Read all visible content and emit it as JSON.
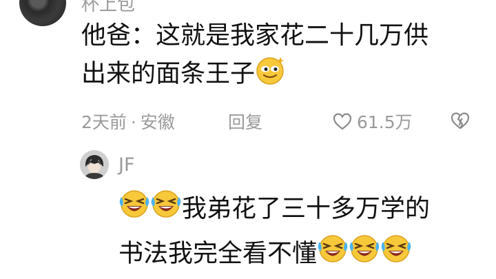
{
  "top_comment": {
    "username": "杯上包",
    "text_line1": "他爸：这就是我家花二十几万供",
    "text_line2": "出来的面条王子",
    "emoji": "smirk-face-emoji",
    "time": "2天前",
    "location": "安徽",
    "reply_label": "回复",
    "like_count": "61.5万"
  },
  "reply": {
    "username": "JF",
    "text_line1": "我弟花了三十多万学的",
    "text_line2": "书法我完全看不懂",
    "emoji": "laughing-crying-emoji"
  },
  "icons": {
    "like": "heart-outline-icon",
    "dislike": "broken-heart-icon"
  },
  "colors": {
    "text": "#111111",
    "secondary": "#9a9a9a",
    "emoji_yellow": "#f7c83a"
  }
}
